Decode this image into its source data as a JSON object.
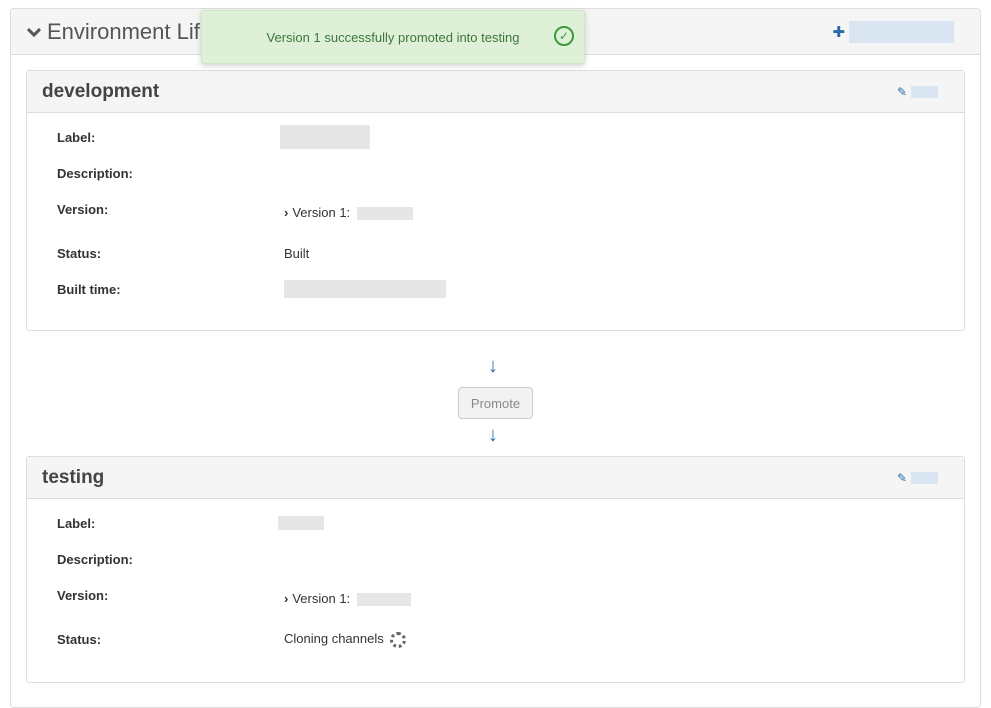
{
  "panel": {
    "title": "Environment Lif",
    "chevron_icon": "chevron-down-icon",
    "add_icon": "plus-icon"
  },
  "toast": {
    "message": "Version 1 successfully promoted into testing",
    "icon": "check-circle-icon",
    "color": "#dff0d8"
  },
  "environments": [
    {
      "name": "development",
      "fields": {
        "label_title": "Label:",
        "description_title": "Description:",
        "version_title": "Version:",
        "status_title": "Status:",
        "built_time_title": "Built time:"
      },
      "version_value": "Version 1:",
      "status_value": "Built"
    },
    {
      "name": "testing",
      "fields": {
        "label_title": "Label:",
        "description_title": "Description:",
        "version_title": "Version:",
        "status_title": "Status:"
      },
      "version_value": "Version 1:",
      "status_value": "Cloning channels"
    }
  ],
  "promote": {
    "label": "Promote"
  },
  "colors": {
    "accent": "#2a6aa8",
    "success": "#3c763d"
  }
}
